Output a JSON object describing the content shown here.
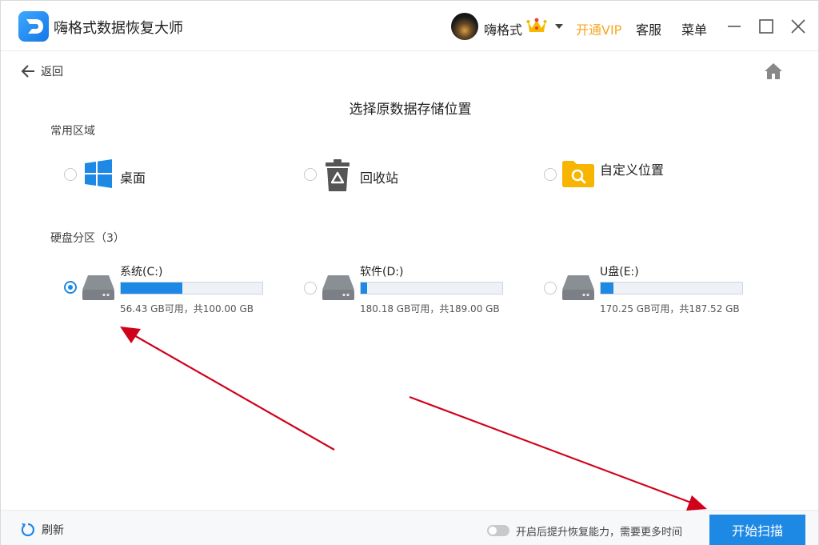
{
  "app": {
    "title": "嗨格式数据恢复大师"
  },
  "header": {
    "username": "嗨格式",
    "vip_label": "开通VIP",
    "service_label": "客服",
    "menu_label": "菜单"
  },
  "nav": {
    "back_label": "返回"
  },
  "page": {
    "title": "选择原数据存储位置"
  },
  "common_section": {
    "label": "常用区域",
    "items": [
      {
        "label": "桌面",
        "icon": "windows-icon",
        "selected": false
      },
      {
        "label": "回收站",
        "icon": "recycle-bin-icon",
        "selected": false
      },
      {
        "label": "自定义位置",
        "icon": "folder-search-icon",
        "selected": false
      }
    ]
  },
  "disk_section": {
    "label": "硬盘分区（3）",
    "drives": [
      {
        "name": "系统(C:)",
        "info": "56.43 GB可用，共100.00 GB",
        "used_fraction": 0.436,
        "selected": true
      },
      {
        "name": "软件(D:)",
        "info": "180.18 GB可用，共189.00 GB",
        "used_fraction": 0.047,
        "selected": false
      },
      {
        "name": "U盘(E:)",
        "info": "170.25 GB可用，共187.52 GB",
        "used_fraction": 0.092,
        "selected": false
      }
    ]
  },
  "footer": {
    "refresh_label": "刷新",
    "toggle_label": "开启后提升恢复能力，需要更多时间",
    "toggle_on": false,
    "start_label": "开始扫描"
  },
  "colors": {
    "accent": "#1e88e5",
    "vip": "#f5a623",
    "annotation_arrow": "#d0021b"
  }
}
